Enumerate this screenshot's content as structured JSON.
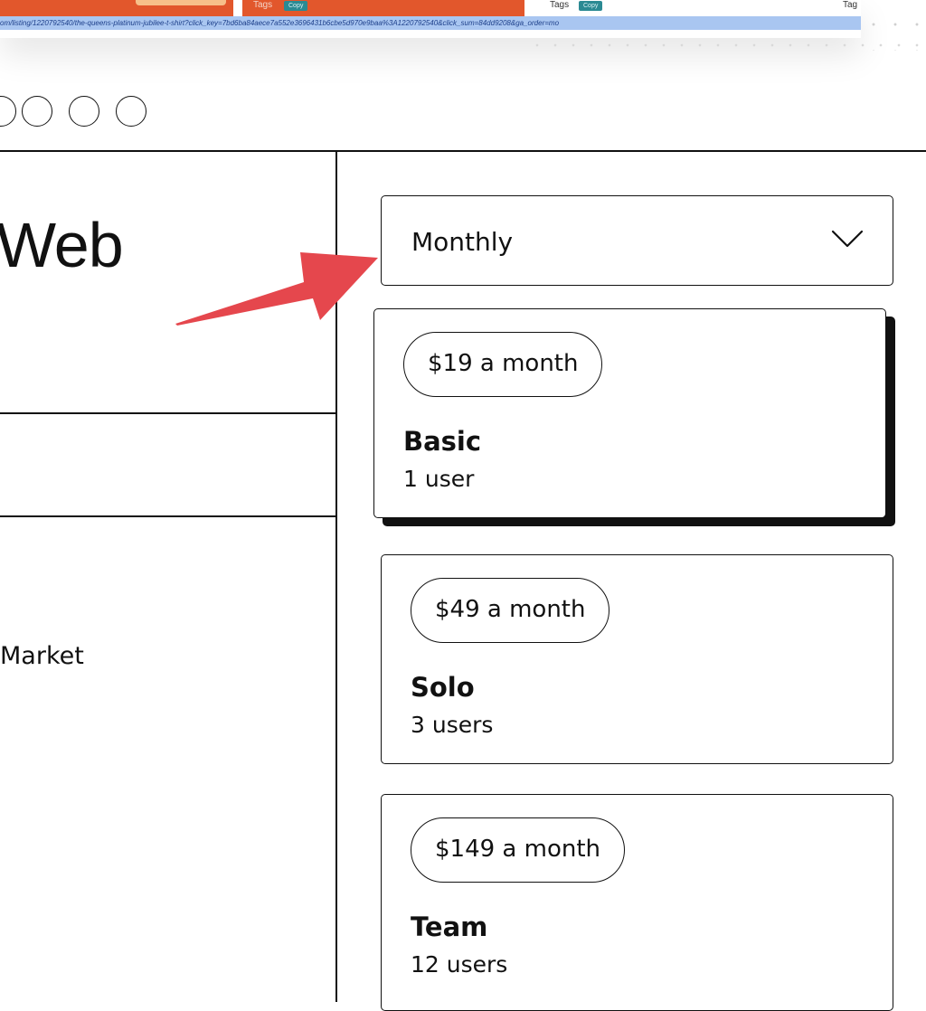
{
  "screenshot_strip": {
    "tags_label": "Tags",
    "copy_label": "Copy",
    "tag_partial": "Tag",
    "url": "om/listing/1220792540/the-queens-platinum-jubilee-t-shirt?click_key=7bd6ba84aece7a552e3696431b6cbe5d970e9baa%3A1220792540&click_sum=84dd9208&ga_order=mo"
  },
  "hero": {
    "title_fragment": "Web",
    "market_fragment": "Market"
  },
  "billing": {
    "selected": "Monthly"
  },
  "plans": [
    {
      "price": "$19 a month",
      "name": "Basic",
      "users": "1 user",
      "selected": true
    },
    {
      "price": "$49 a month",
      "name": "Solo",
      "users": "3 users",
      "selected": false
    },
    {
      "price": "$149 a month",
      "name": "Team",
      "users": "12 users",
      "selected": false
    }
  ],
  "colors": {
    "annotation_arrow": "#e5474d",
    "tag_orange": "#e2572c",
    "copy_chip": "#2b8a93"
  },
  "icons": {
    "select": "chevron-down-icon",
    "annotation": "red-arrow-annotation"
  }
}
